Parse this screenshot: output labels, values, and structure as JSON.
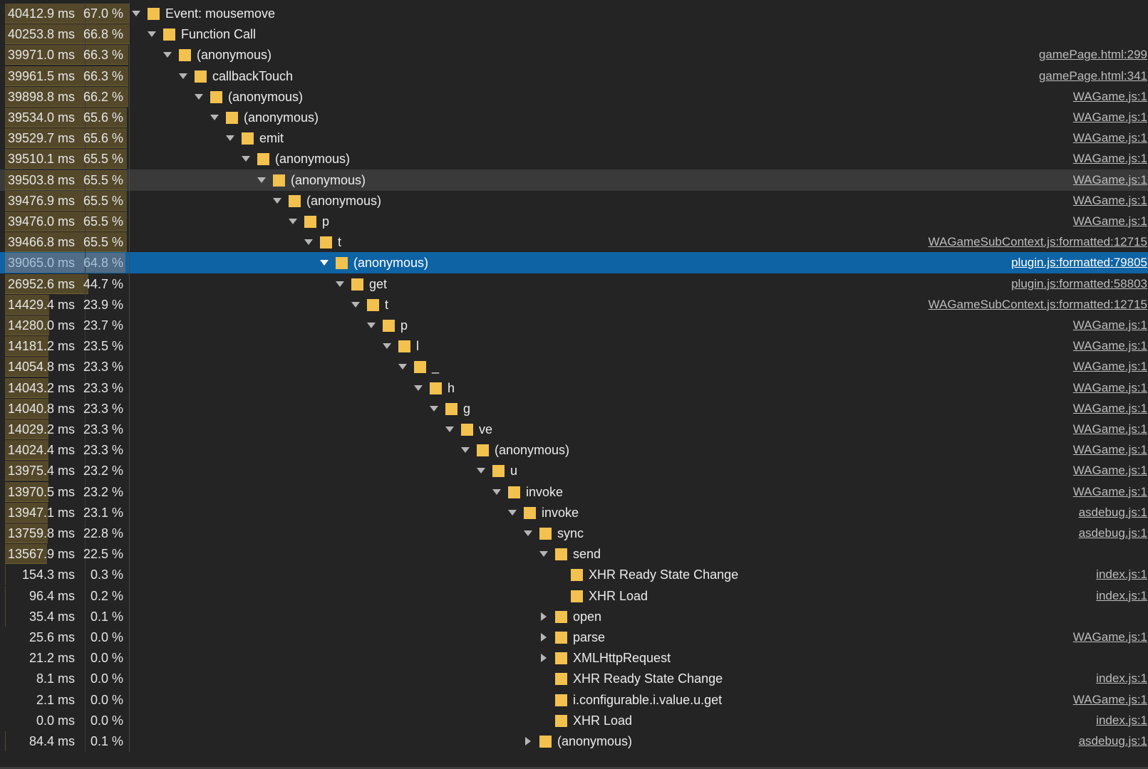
{
  "colors": {
    "background": "#242424",
    "selected_row": "#0e63a4",
    "hover_row": "#3a3a3a",
    "bar_fill": "#54482a",
    "category_swatch": "#f2c14e"
  },
  "icons": {
    "expanded": "triangle-down-icon",
    "collapsed": "triangle-right-icon",
    "category": "scripting-category-swatch"
  },
  "rows": [
    {
      "time": "40412.9 ms",
      "pct": "67.0 %",
      "name": "Event: mousemove",
      "url": "",
      "depth": 0,
      "toggle": "open",
      "ratio": 0.67
    },
    {
      "time": "40253.8 ms",
      "pct": "66.8 %",
      "name": "Function Call",
      "url": "",
      "depth": 1,
      "toggle": "open",
      "ratio": 0.668
    },
    {
      "time": "39971.0 ms",
      "pct": "66.3 %",
      "name": "(anonymous)",
      "url": "gamePage.html:299",
      "depth": 2,
      "toggle": "open",
      "ratio": 0.663
    },
    {
      "time": "39961.5 ms",
      "pct": "66.3 %",
      "name": "callbackTouch",
      "url": "gamePage.html:341",
      "depth": 3,
      "toggle": "open",
      "ratio": 0.663
    },
    {
      "time": "39898.8 ms",
      "pct": "66.2 %",
      "name": "(anonymous)",
      "url": "WAGame.js:1",
      "depth": 4,
      "toggle": "open",
      "ratio": 0.662
    },
    {
      "time": "39534.0 ms",
      "pct": "65.6 %",
      "name": "(anonymous)",
      "url": "WAGame.js:1",
      "depth": 5,
      "toggle": "open",
      "ratio": 0.656
    },
    {
      "time": "39529.7 ms",
      "pct": "65.6 %",
      "name": "emit",
      "url": "WAGame.js:1",
      "depth": 6,
      "toggle": "open",
      "ratio": 0.656
    },
    {
      "time": "39510.1 ms",
      "pct": "65.5 %",
      "name": "(anonymous)",
      "url": "WAGame.js:1",
      "depth": 7,
      "toggle": "open",
      "ratio": 0.655
    },
    {
      "time": "39503.8 ms",
      "pct": "65.5 %",
      "name": "(anonymous)",
      "url": "WAGame.js:1",
      "depth": 8,
      "toggle": "open",
      "ratio": 0.655,
      "state": "hover"
    },
    {
      "time": "39476.9 ms",
      "pct": "65.5 %",
      "name": "(anonymous)",
      "url": "WAGame.js:1",
      "depth": 9,
      "toggle": "open",
      "ratio": 0.655
    },
    {
      "time": "39476.0 ms",
      "pct": "65.5 %",
      "name": "p",
      "url": "WAGame.js:1",
      "depth": 10,
      "toggle": "open",
      "ratio": 0.655
    },
    {
      "time": "39466.8 ms",
      "pct": "65.5 %",
      "name": "t",
      "url": "WAGameSubContext.js:formatted:12715",
      "depth": 11,
      "toggle": "open",
      "ratio": 0.655
    },
    {
      "time": "39065.0 ms",
      "pct": "64.8 %",
      "name": "(anonymous)",
      "url": "plugin.js:formatted:79805",
      "depth": 12,
      "toggle": "open",
      "ratio": 0.648,
      "state": "selected"
    },
    {
      "time": "26952.6 ms",
      "pct": "44.7 %",
      "name": "get",
      "url": "plugin.js:formatted:58803",
      "depth": 13,
      "toggle": "open",
      "ratio": 0.447
    },
    {
      "time": "14429.4 ms",
      "pct": "23.9 %",
      "name": "t",
      "url": "WAGameSubContext.js:formatted:12715",
      "depth": 14,
      "toggle": "open",
      "ratio": 0.239
    },
    {
      "time": "14280.0 ms",
      "pct": "23.7 %",
      "name": "p",
      "url": "WAGame.js:1",
      "depth": 15,
      "toggle": "open",
      "ratio": 0.237
    },
    {
      "time": "14181.2 ms",
      "pct": "23.5 %",
      "name": "l",
      "url": "WAGame.js:1",
      "depth": 16,
      "toggle": "open",
      "ratio": 0.235
    },
    {
      "time": "14054.8 ms",
      "pct": "23.3 %",
      "name": "_",
      "url": "WAGame.js:1",
      "depth": 17,
      "toggle": "open",
      "ratio": 0.233
    },
    {
      "time": "14043.2 ms",
      "pct": "23.3 %",
      "name": "h",
      "url": "WAGame.js:1",
      "depth": 18,
      "toggle": "open",
      "ratio": 0.233
    },
    {
      "time": "14040.8 ms",
      "pct": "23.3 %",
      "name": "g",
      "url": "WAGame.js:1",
      "depth": 19,
      "toggle": "open",
      "ratio": 0.233
    },
    {
      "time": "14029.2 ms",
      "pct": "23.3 %",
      "name": "ve",
      "url": "WAGame.js:1",
      "depth": 20,
      "toggle": "open",
      "ratio": 0.233
    },
    {
      "time": "14024.4 ms",
      "pct": "23.3 %",
      "name": "(anonymous)",
      "url": "WAGame.js:1",
      "depth": 21,
      "toggle": "open",
      "ratio": 0.233
    },
    {
      "time": "13975.4 ms",
      "pct": "23.2 %",
      "name": "u",
      "url": "WAGame.js:1",
      "depth": 22,
      "toggle": "open",
      "ratio": 0.232
    },
    {
      "time": "13970.5 ms",
      "pct": "23.2 %",
      "name": "invoke",
      "url": "WAGame.js:1",
      "depth": 23,
      "toggle": "open",
      "ratio": 0.232
    },
    {
      "time": "13947.1 ms",
      "pct": "23.1 %",
      "name": "invoke",
      "url": "asdebug.js:1",
      "depth": 24,
      "toggle": "open",
      "ratio": 0.231
    },
    {
      "time": "13759.8 ms",
      "pct": "22.8 %",
      "name": "sync",
      "url": "asdebug.js:1",
      "depth": 25,
      "toggle": "open",
      "ratio": 0.228
    },
    {
      "time": "13567.9 ms",
      "pct": "22.5 %",
      "name": "send",
      "url": "",
      "depth": 26,
      "toggle": "open",
      "ratio": 0.225
    },
    {
      "time": "154.3 ms",
      "pct": "0.3 %",
      "name": "XHR Ready State Change",
      "url": "index.js:1",
      "depth": 27,
      "toggle": "none",
      "ratio": 0.003
    },
    {
      "time": "96.4 ms",
      "pct": "0.2 %",
      "name": "XHR Load",
      "url": "index.js:1",
      "depth": 27,
      "toggle": "none",
      "ratio": 0.002
    },
    {
      "time": "35.4 ms",
      "pct": "0.1 %",
      "name": "open",
      "url": "",
      "depth": 26,
      "toggle": "closed",
      "ratio": 0.001
    },
    {
      "time": "25.6 ms",
      "pct": "0.0 %",
      "name": "parse",
      "url": "WAGame.js:1",
      "depth": 26,
      "toggle": "closed",
      "ratio": 0.0
    },
    {
      "time": "21.2 ms",
      "pct": "0.0 %",
      "name": "XMLHttpRequest",
      "url": "",
      "depth": 26,
      "toggle": "closed",
      "ratio": 0.0
    },
    {
      "time": "8.1 ms",
      "pct": "0.0 %",
      "name": "XHR Ready State Change",
      "url": "index.js:1",
      "depth": 26,
      "toggle": "none",
      "ratio": 0.0
    },
    {
      "time": "2.1 ms",
      "pct": "0.0 %",
      "name": "i.configurable.i.value.u.get",
      "url": "WAGame.js:1",
      "depth": 26,
      "toggle": "none",
      "ratio": 0.0
    },
    {
      "time": "0.0 ms",
      "pct": "0.0 %",
      "name": "XHR Load",
      "url": "index.js:1",
      "depth": 26,
      "toggle": "none",
      "ratio": 0.0
    },
    {
      "time": "84.4 ms",
      "pct": "0.1 %",
      "name": "(anonymous)",
      "url": "asdebug.js:1",
      "depth": 25,
      "toggle": "closed",
      "ratio": 0.001
    }
  ]
}
